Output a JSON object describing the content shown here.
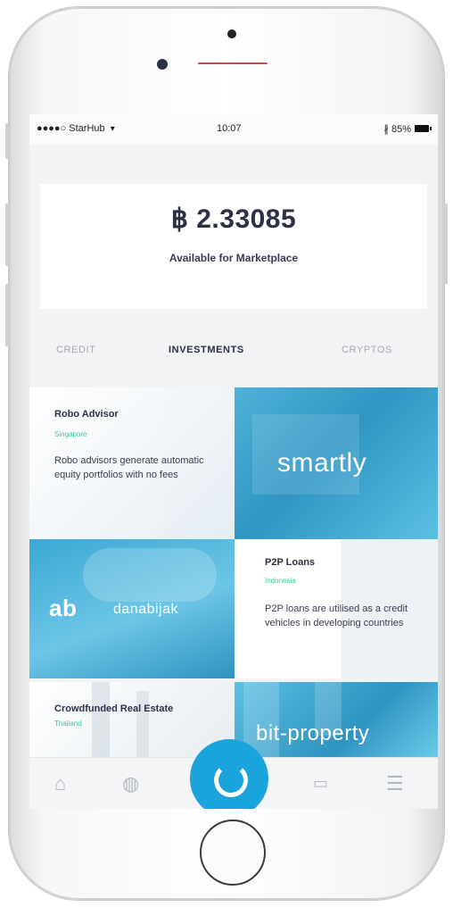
{
  "status_bar": {
    "carrier": "●●●●○ StarHub",
    "time": "10:07",
    "battery": "85%",
    "bluetooth": "∦"
  },
  "balance": {
    "amount": "฿ 2.33085",
    "label": "Available for Marketplace"
  },
  "tabs": [
    {
      "label": "CREDIT",
      "active": false
    },
    {
      "label": "INVESTMENTS",
      "active": true
    },
    {
      "label": "CRYPTOS",
      "active": false
    }
  ],
  "tiles": {
    "robo_advisor": {
      "title": "Robo Advisor",
      "tag": "Singapore",
      "description": "Robo advisors generate automatic equity portfolios with no fees"
    },
    "smartly": {
      "brand": "smartly"
    },
    "danabijak": {
      "brand": "danabijak"
    },
    "p2p_loans": {
      "title": "P2P Loans",
      "tag": "Indonesia",
      "description": "P2P loans are utilised as a credit vehicles in developing countries"
    },
    "crowdfunded": {
      "title": "Crowdfunded Real Estate",
      "tag": "Thailand"
    },
    "bitproperty": {
      "brand": "bit-property"
    }
  },
  "tabbar": {
    "home_icon": "home-icon",
    "globe_icon": "globe-icon",
    "card_icon": "card-icon",
    "menu_icon": "menu-icon"
  },
  "colors": {
    "accent": "#1ba3dc",
    "tag_green": "#3cc79f",
    "text_dark": "#2d2f45"
  }
}
